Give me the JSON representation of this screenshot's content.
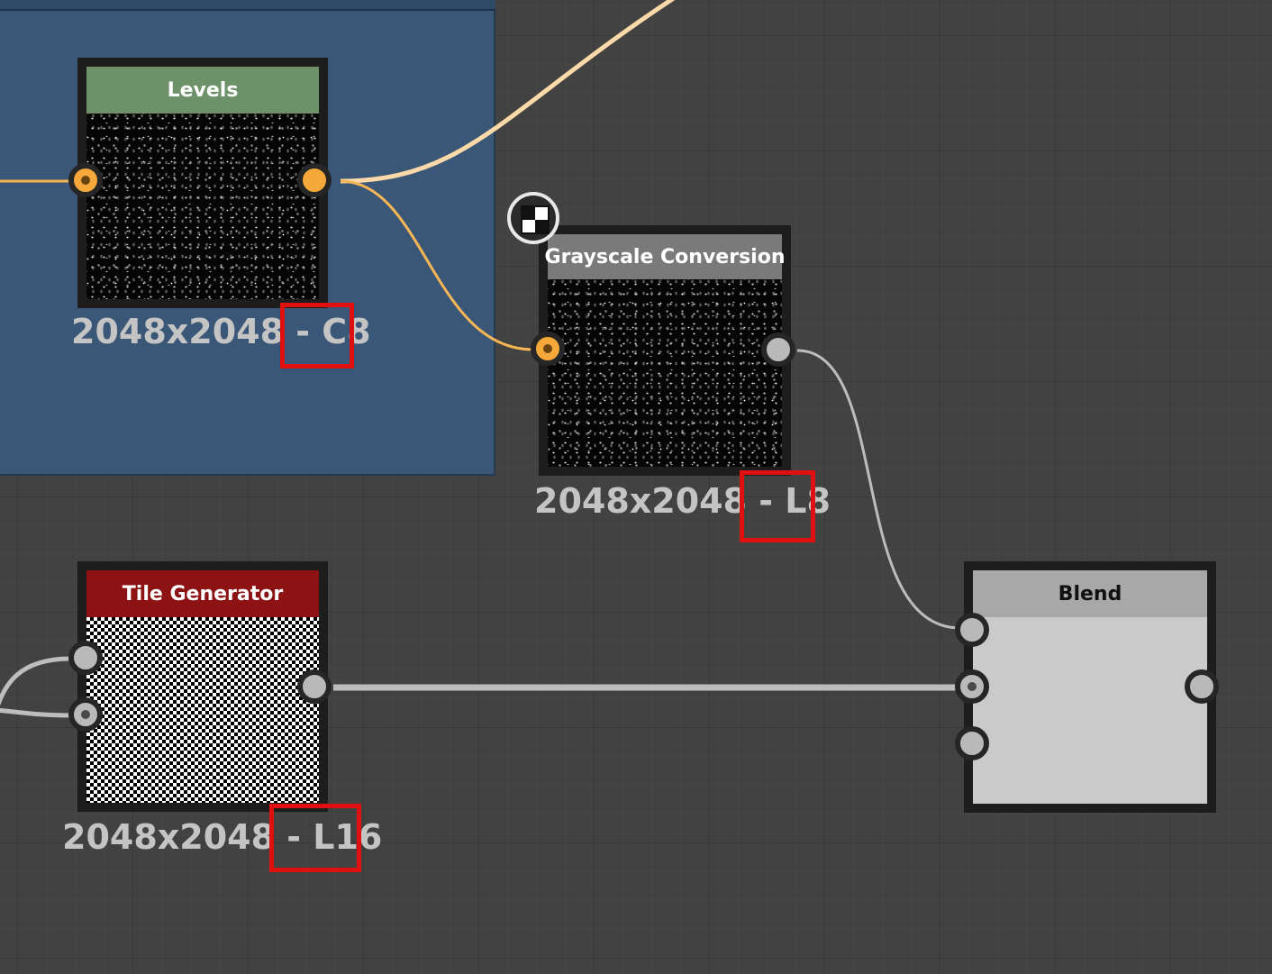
{
  "colors": {
    "canvas": "#424242",
    "frame": "#3a5777",
    "wire_color": "#f7b655",
    "wire_color_light": "#fbd9a8",
    "wire_grey": "#bdbdbd",
    "port_orange": "#f7a83a",
    "port_grey": "#b9b9b9",
    "highlight": "#e01010",
    "levels_header": "#6d926a",
    "grayscale_header": "#7a7a7a",
    "tile_header": "#8c1214",
    "blend_header": "#a8a8a8",
    "blend_body": "#cacaca"
  },
  "nodes": {
    "levels": {
      "title": "Levels",
      "resolution": "2048x2048 - ",
      "format": "C8"
    },
    "grayscale": {
      "title": "Grayscale Conversion",
      "resolution": "2048x2048 - ",
      "format": "L8",
      "icon": "grayscale-icon"
    },
    "tile": {
      "title": "Tile Generator",
      "resolution": "2048x2048 - ",
      "format": "L16"
    },
    "blend": {
      "title": "Blend"
    }
  }
}
